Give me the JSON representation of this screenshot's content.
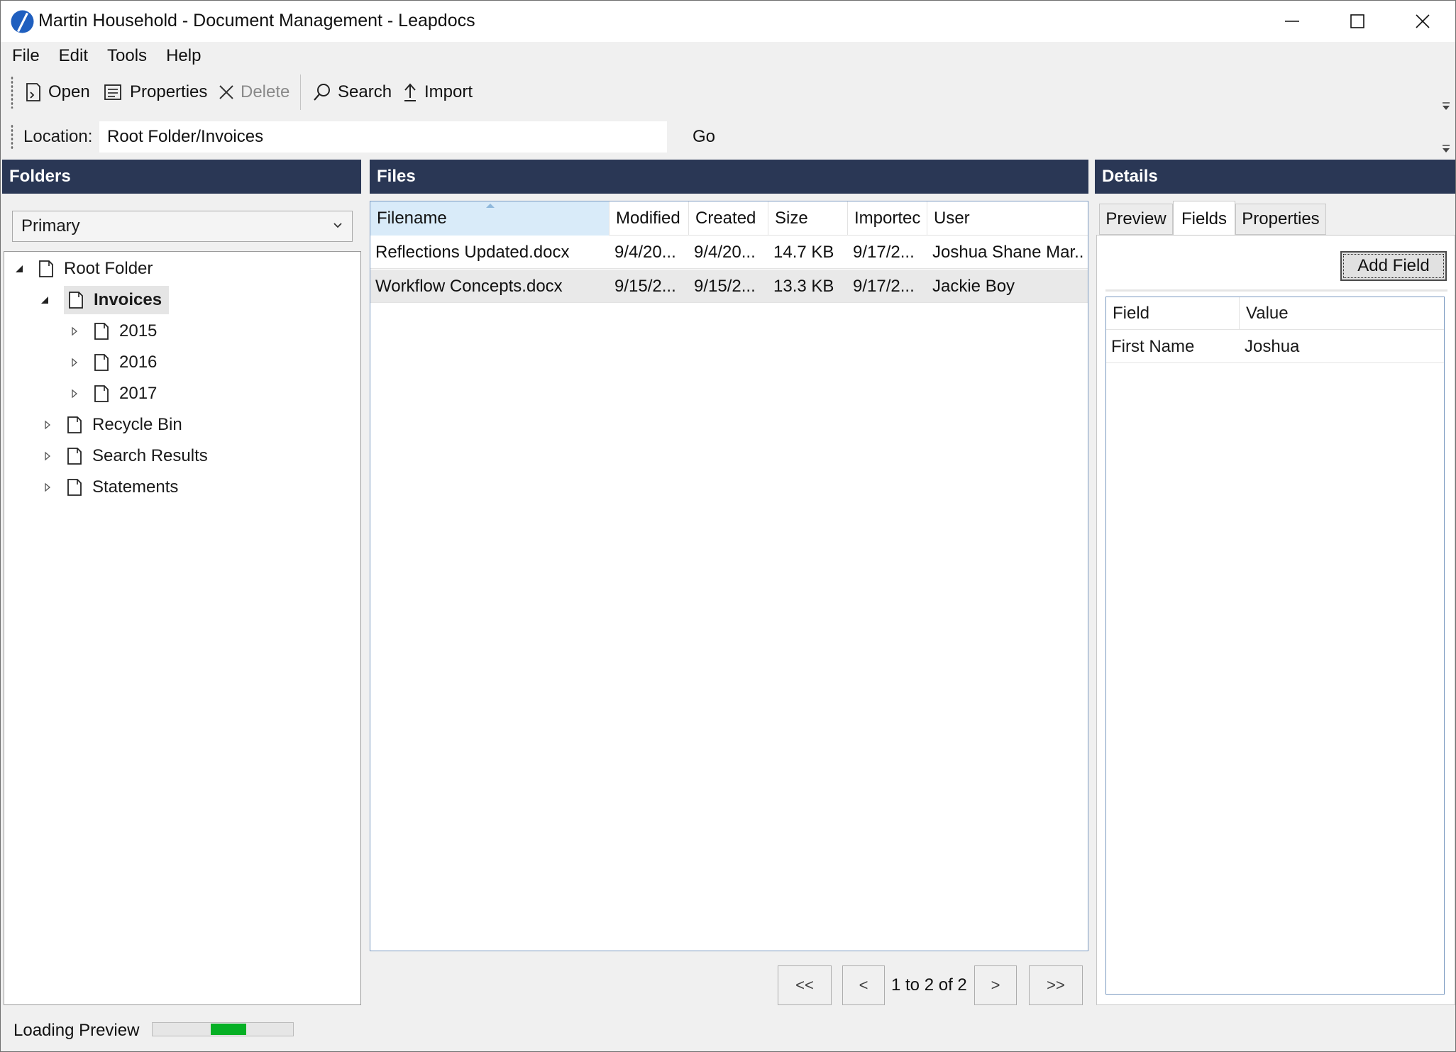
{
  "window": {
    "title": "Martin Household - Document Management - Leapdocs"
  },
  "menu": [
    "File",
    "Edit",
    "Tools",
    "Help"
  ],
  "toolbar": {
    "open_label": "Open",
    "properties_label": "Properties",
    "delete_label": "Delete",
    "search_label": "Search",
    "import_label": "Import"
  },
  "location": {
    "label": "Location:",
    "value": "Root Folder/Invoices",
    "go_label": "Go"
  },
  "folders": {
    "header": "Folders",
    "dropdown_value": "Primary",
    "tree": [
      {
        "label": "Root Folder",
        "expanded": true
      },
      {
        "label": "Invoices",
        "expanded": true,
        "selected": true
      },
      {
        "label": "2015"
      },
      {
        "label": "2016"
      },
      {
        "label": "2017"
      },
      {
        "label": "Recycle Bin"
      },
      {
        "label": "Search Results"
      },
      {
        "label": "Statements"
      }
    ]
  },
  "files": {
    "header": "Files",
    "columns": [
      "Filename",
      "Modified",
      "Created",
      "Size",
      "Importec",
      "User"
    ],
    "rows": [
      [
        "Reflections Updated.docx",
        "9/4/20...",
        "9/4/20...",
        "14.7 KB",
        "9/17/2...",
        "Joshua Shane Mar..."
      ],
      [
        "Workflow Concepts.docx",
        "9/15/2...",
        "9/15/2...",
        "13.3 KB",
        "9/17/2...",
        "Jackie Boy"
      ]
    ],
    "pager": {
      "first": "<<",
      "prev": "<",
      "status": "1 to 2 of 2",
      "next": ">",
      "last": ">>"
    }
  },
  "details": {
    "header": "Details",
    "tabs": [
      "Preview",
      "Fields",
      "Properties"
    ],
    "active_tab": "Fields",
    "add_field_label": "Add Field",
    "columns": [
      "Field",
      "Value"
    ],
    "rows": [
      [
        "First Name",
        "Joshua"
      ]
    ]
  },
  "status": {
    "text": "Loading Preview",
    "progress_fraction": 0.25,
    "progress_color": "#06b025"
  },
  "colors": {
    "panel_header": "#2a3755",
    "logo": "#1f5fbf"
  }
}
